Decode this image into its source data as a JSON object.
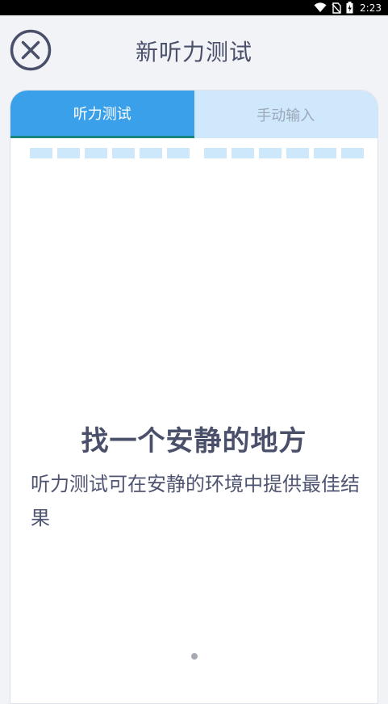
{
  "status_bar": {
    "time": "2:23",
    "icons": [
      "wifi-icon",
      "no-sim-icon",
      "battery-charging-icon"
    ]
  },
  "header": {
    "title": "新听力测试",
    "close_icon": "close-icon"
  },
  "tabs": [
    {
      "label": "听力测试",
      "active": true
    },
    {
      "label": "手动输入",
      "active": false
    }
  ],
  "progress": {
    "left_group_segments": 6,
    "right_group_segments": 6,
    "completed_segments": 0
  },
  "content": {
    "headline": "找一个安静的地方",
    "description": "听力测试可在安静的环境中提供最佳结果"
  },
  "pager": {
    "pages": 1,
    "current": 1
  },
  "colors": {
    "accent": "#3aa0ea",
    "tab_inactive_bg": "#cfe8fb",
    "progress_segment": "#cde8fb",
    "text": "#4a4f6a"
  }
}
